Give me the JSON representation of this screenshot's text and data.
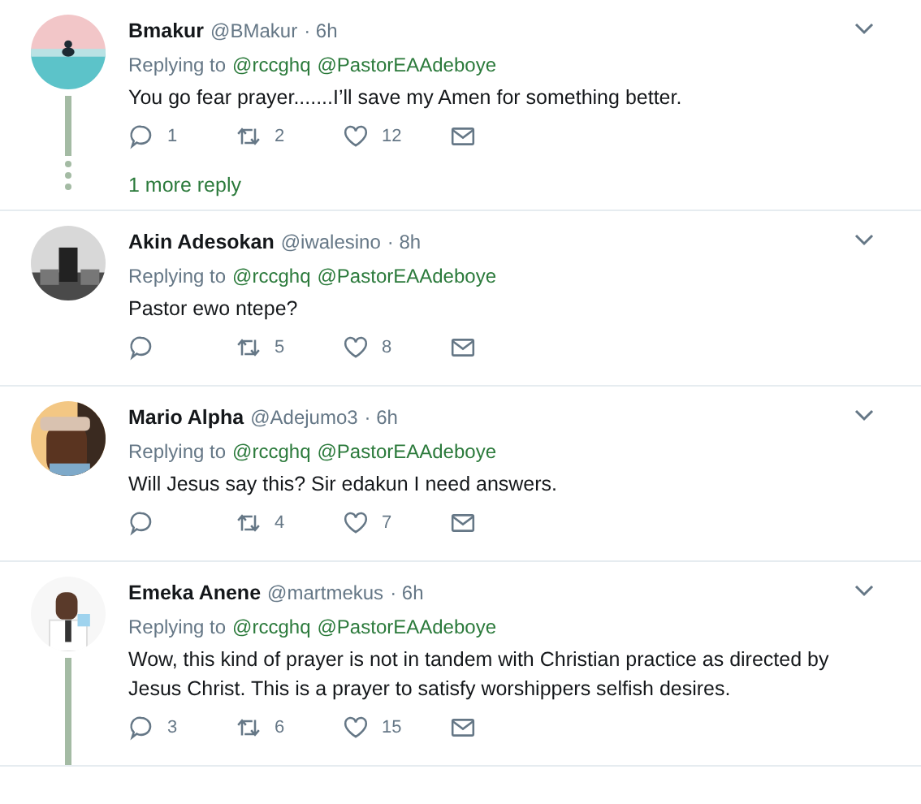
{
  "tweets": [
    {
      "name": "Bmakur",
      "handle": "@BMakur",
      "time": "· 6h",
      "replying_label": "Replying to",
      "replying_to": [
        "@rccghq",
        "@PastorEAAdeboye"
      ],
      "text": "You go fear prayer.......I’ll save my Amen for something better.",
      "replies": "1",
      "retweets": "2",
      "likes": "12",
      "thread": true,
      "more_replies": "1 more reply"
    },
    {
      "name": "Akin Adesokan",
      "handle": "@iwalesino",
      "time": "· 8h",
      "replying_label": "Replying to",
      "replying_to": [
        "@rccghq",
        "@PastorEAAdeboye"
      ],
      "text": "Pastor ewo ntepe?",
      "retweets": "5",
      "likes": "8",
      "thread": false
    },
    {
      "name": "Mario Alpha",
      "handle": "@Adejumo3",
      "time": "· 6h",
      "replying_label": "Replying to",
      "replying_to": [
        "@rccghq",
        "@PastorEAAdeboye"
      ],
      "text": "Will Jesus say this? Sir edakun I need answers.",
      "retweets": "4",
      "likes": "7",
      "thread": false
    },
    {
      "name": "Emeka Anene",
      "handle": "@martmekus",
      "time": "· 6h",
      "replying_label": "Replying to",
      "replying_to": [
        "@rccghq",
        "@PastorEAAdeboye"
      ],
      "text": "Wow, this kind of prayer is not in tandem with Christian practice as directed by Jesus Christ. This is a prayer to satisfy worshippers selfish desires.",
      "replies": "3",
      "retweets": "6",
      "likes": "15",
      "thread": true
    }
  ]
}
